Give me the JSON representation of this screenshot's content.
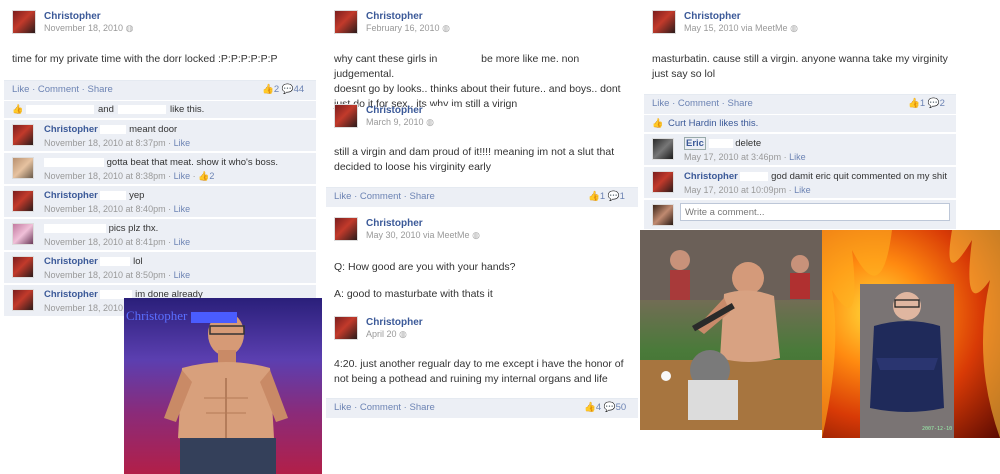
{
  "left": {
    "post": {
      "name": "Christopher",
      "time": "November 18, 2010",
      "text": "time for my private time with the dorr locked :P:P:P:P:P:P",
      "actions": "Like · Comment · Share",
      "likes_count": "2",
      "comments_count": "44",
      "like_line_mid": "and",
      "like_line_end": "like this."
    },
    "comments": [
      {
        "name": "Christopher",
        "text": "meant door",
        "time": "November 18, 2010 at 8:37pm",
        "like": "Like"
      },
      {
        "name": "",
        "text": "gotta beat that meat. show it who's boss.",
        "time": "November 18, 2010 at 8:38pm",
        "like": "Like",
        "extra": "2"
      },
      {
        "name": "Christopher",
        "text": "yep",
        "time": "November 18, 2010 at 8:40pm",
        "like": "Like"
      },
      {
        "name": "",
        "text": "pics plz thx.",
        "time": "November 18, 2010 at 8:41pm",
        "like": "Like"
      },
      {
        "name": "Christopher",
        "text": "lol",
        "time": "November 18, 2010 at 8:50pm",
        "like": "Like"
      },
      {
        "name": "Christopher",
        "text": "im done already",
        "time": "November 18, 2010",
        "like": ""
      }
    ],
    "photo_caption": "Christopher"
  },
  "middle": {
    "post1": {
      "name": "Christopher",
      "time": "February 16, 2010",
      "text_a": "why cant these girls in",
      "text_b": "be more like me. non judgemental.",
      "text_c": "doesnt go by looks.. thinks about their future.. and boys.. dont",
      "text_d": "just do it for sex.. its why im still a virign"
    },
    "post2": {
      "name": "Christopher",
      "time": "March 9, 2010",
      "text_a": "still a virgin and dam proud of it!!!! meaning im not a slut that",
      "text_b": "decided to loose his virginity early",
      "actions": "Like · Comment · Share",
      "likes_count": "1",
      "comments_count": "1"
    },
    "post3": {
      "name": "Christopher",
      "time": "May 30, 2010 via MeetMe",
      "q": "Q: How good are you with your hands?",
      "a": "A: good to masturbate with thats it"
    },
    "post4": {
      "name": "Christopher",
      "time": "April 20",
      "text_a": "4:20. just another regualr day to me except i have the honor of",
      "text_b": "not being a pothead and ruining my internal organs and life",
      "actions": "Like · Comment · Share",
      "likes_count": "4",
      "comments_count": "50"
    }
  },
  "right": {
    "post": {
      "name": "Christopher",
      "time": "May 15, 2010 via MeetMe",
      "text_a": "masturbatin. cause still a virgin. anyone wanna take my virginity",
      "text_b": "just say so lol",
      "actions": "Like · Comment · Share",
      "likes_count": "1",
      "comments_count": "2",
      "likes_line": "Curt Hardin likes this."
    },
    "comments": [
      {
        "name": "Eric",
        "text": "delete",
        "time": "May 17, 2010 at 3:46pm",
        "like": "Like"
      },
      {
        "name": "Christopher",
        "text": "god damit eric quit commented on my shit",
        "time": "May 17, 2010 at 10:09pm",
        "like": "Like"
      }
    ],
    "write_placeholder": "Write a comment..."
  },
  "colors": {
    "link": "#3b5998",
    "muted_link": "#6d84b4",
    "bar": "#eceff5"
  }
}
